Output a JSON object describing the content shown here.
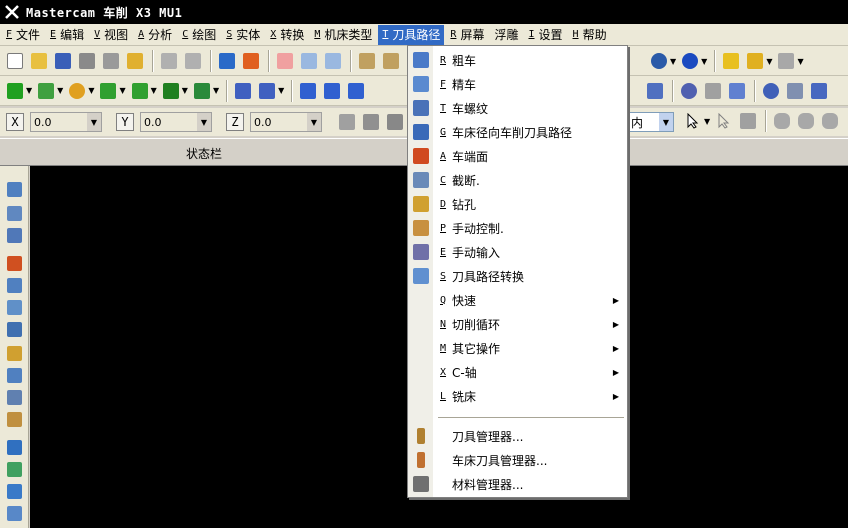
{
  "window": {
    "title": "Mastercam 车削  X3 MU1"
  },
  "menubar": [
    {
      "acc": "F",
      "label": "文件"
    },
    {
      "acc": "E",
      "label": "编辑"
    },
    {
      "acc": "V",
      "label": "视图"
    },
    {
      "acc": "A",
      "label": "分析"
    },
    {
      "acc": "C",
      "label": "绘图"
    },
    {
      "acc": "S",
      "label": "实体"
    },
    {
      "acc": "X",
      "label": "转换"
    },
    {
      "acc": "M",
      "label": "机床类型"
    },
    {
      "acc": "T",
      "label": "刀具路径"
    },
    {
      "acc": "R",
      "label": "屏幕"
    },
    {
      "acc": "",
      "label": "浮雕"
    },
    {
      "acc": "I",
      "label": "设置"
    },
    {
      "acc": "H",
      "label": "帮助"
    }
  ],
  "coords": {
    "x": {
      "axis": "X",
      "value": "0.0"
    },
    "y": {
      "axis": "Y",
      "value": "0.0"
    },
    "z": {
      "axis": "Z",
      "value": "0.0"
    }
  },
  "units": "内",
  "statusbar": {
    "label": "状态栏"
  },
  "toolpath_menu": {
    "items": [
      {
        "acc": "R",
        "label": "粗车",
        "icon": "rough-turn-icon",
        "submenu": false
      },
      {
        "acc": "F",
        "label": "精车",
        "icon": "finish-turn-icon",
        "submenu": false
      },
      {
        "acc": "T",
        "label": "车螺纹",
        "icon": "thread-icon",
        "submenu": false
      },
      {
        "acc": "G",
        "label": "车床径向车削刀具路径",
        "icon": "groove-icon",
        "submenu": false
      },
      {
        "acc": "A",
        "label": "车端面",
        "icon": "face-icon",
        "submenu": false
      },
      {
        "acc": "C",
        "label": "截断.",
        "icon": "cutoff-icon",
        "submenu": false
      },
      {
        "acc": "D",
        "label": "钻孔",
        "icon": "drill-icon",
        "submenu": false
      },
      {
        "acc": "P",
        "label": "手动控制.",
        "icon": "manual-control-icon",
        "submenu": false
      },
      {
        "acc": "E",
        "label": "手动输入",
        "icon": "manual-entry-icon",
        "submenu": false
      },
      {
        "acc": "S",
        "label": "刀具路径转换",
        "icon": "transform-icon",
        "submenu": false
      },
      {
        "acc": "Q",
        "label": "快速",
        "icon": "",
        "submenu": true
      },
      {
        "acc": "N",
        "label": "切削循环",
        "icon": "",
        "submenu": true
      },
      {
        "acc": "M",
        "label": "其它操作",
        "icon": "",
        "submenu": true
      },
      {
        "acc": "X",
        "label": "C-轴",
        "icon": "",
        "submenu": true
      },
      {
        "acc": "L",
        "label": "铣床",
        "icon": "",
        "submenu": true
      },
      {
        "acc": "",
        "label": "刀具管理器...",
        "icon": "tool-manager-icon",
        "submenu": false
      },
      {
        "acc": "",
        "label": "车床刀具管理器...",
        "icon": "lathe-tool-manager-icon",
        "submenu": false
      },
      {
        "acc": "",
        "label": "材料管理器...",
        "icon": "material-manager-icon",
        "submenu": false
      }
    ]
  },
  "colors": {
    "titlebar": "#000000",
    "menu_highlight": "#316ac5",
    "canvas": "#000000"
  }
}
